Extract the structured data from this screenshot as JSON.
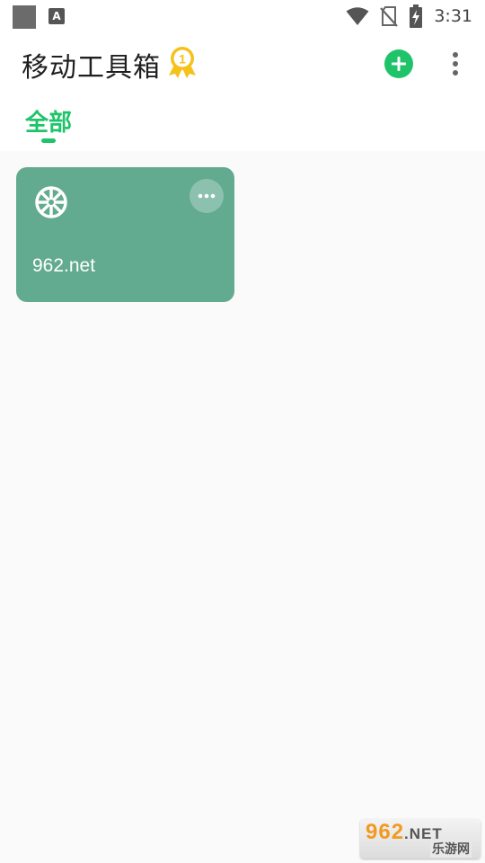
{
  "status_bar": {
    "time": "3:31",
    "notification_letter": "A",
    "icons": [
      "wifi-icon",
      "no-sim-icon",
      "battery-charging-icon"
    ]
  },
  "header": {
    "title": "移动工具箱",
    "badge_number": "1",
    "actions": [
      "add-icon",
      "more-vertical-icon"
    ]
  },
  "tabs": [
    {
      "label": "全部",
      "selected": true
    }
  ],
  "tools": [
    {
      "label": "962.net",
      "icon": "spoke-wheel-icon",
      "color": "#62aa90"
    }
  ],
  "watermark": {
    "main": "962",
    "suffix": ".NET",
    "sub": "乐游网"
  },
  "colors": {
    "accent": "#1fc46a",
    "card": "#62aa90",
    "badge": "#f5c21b"
  }
}
